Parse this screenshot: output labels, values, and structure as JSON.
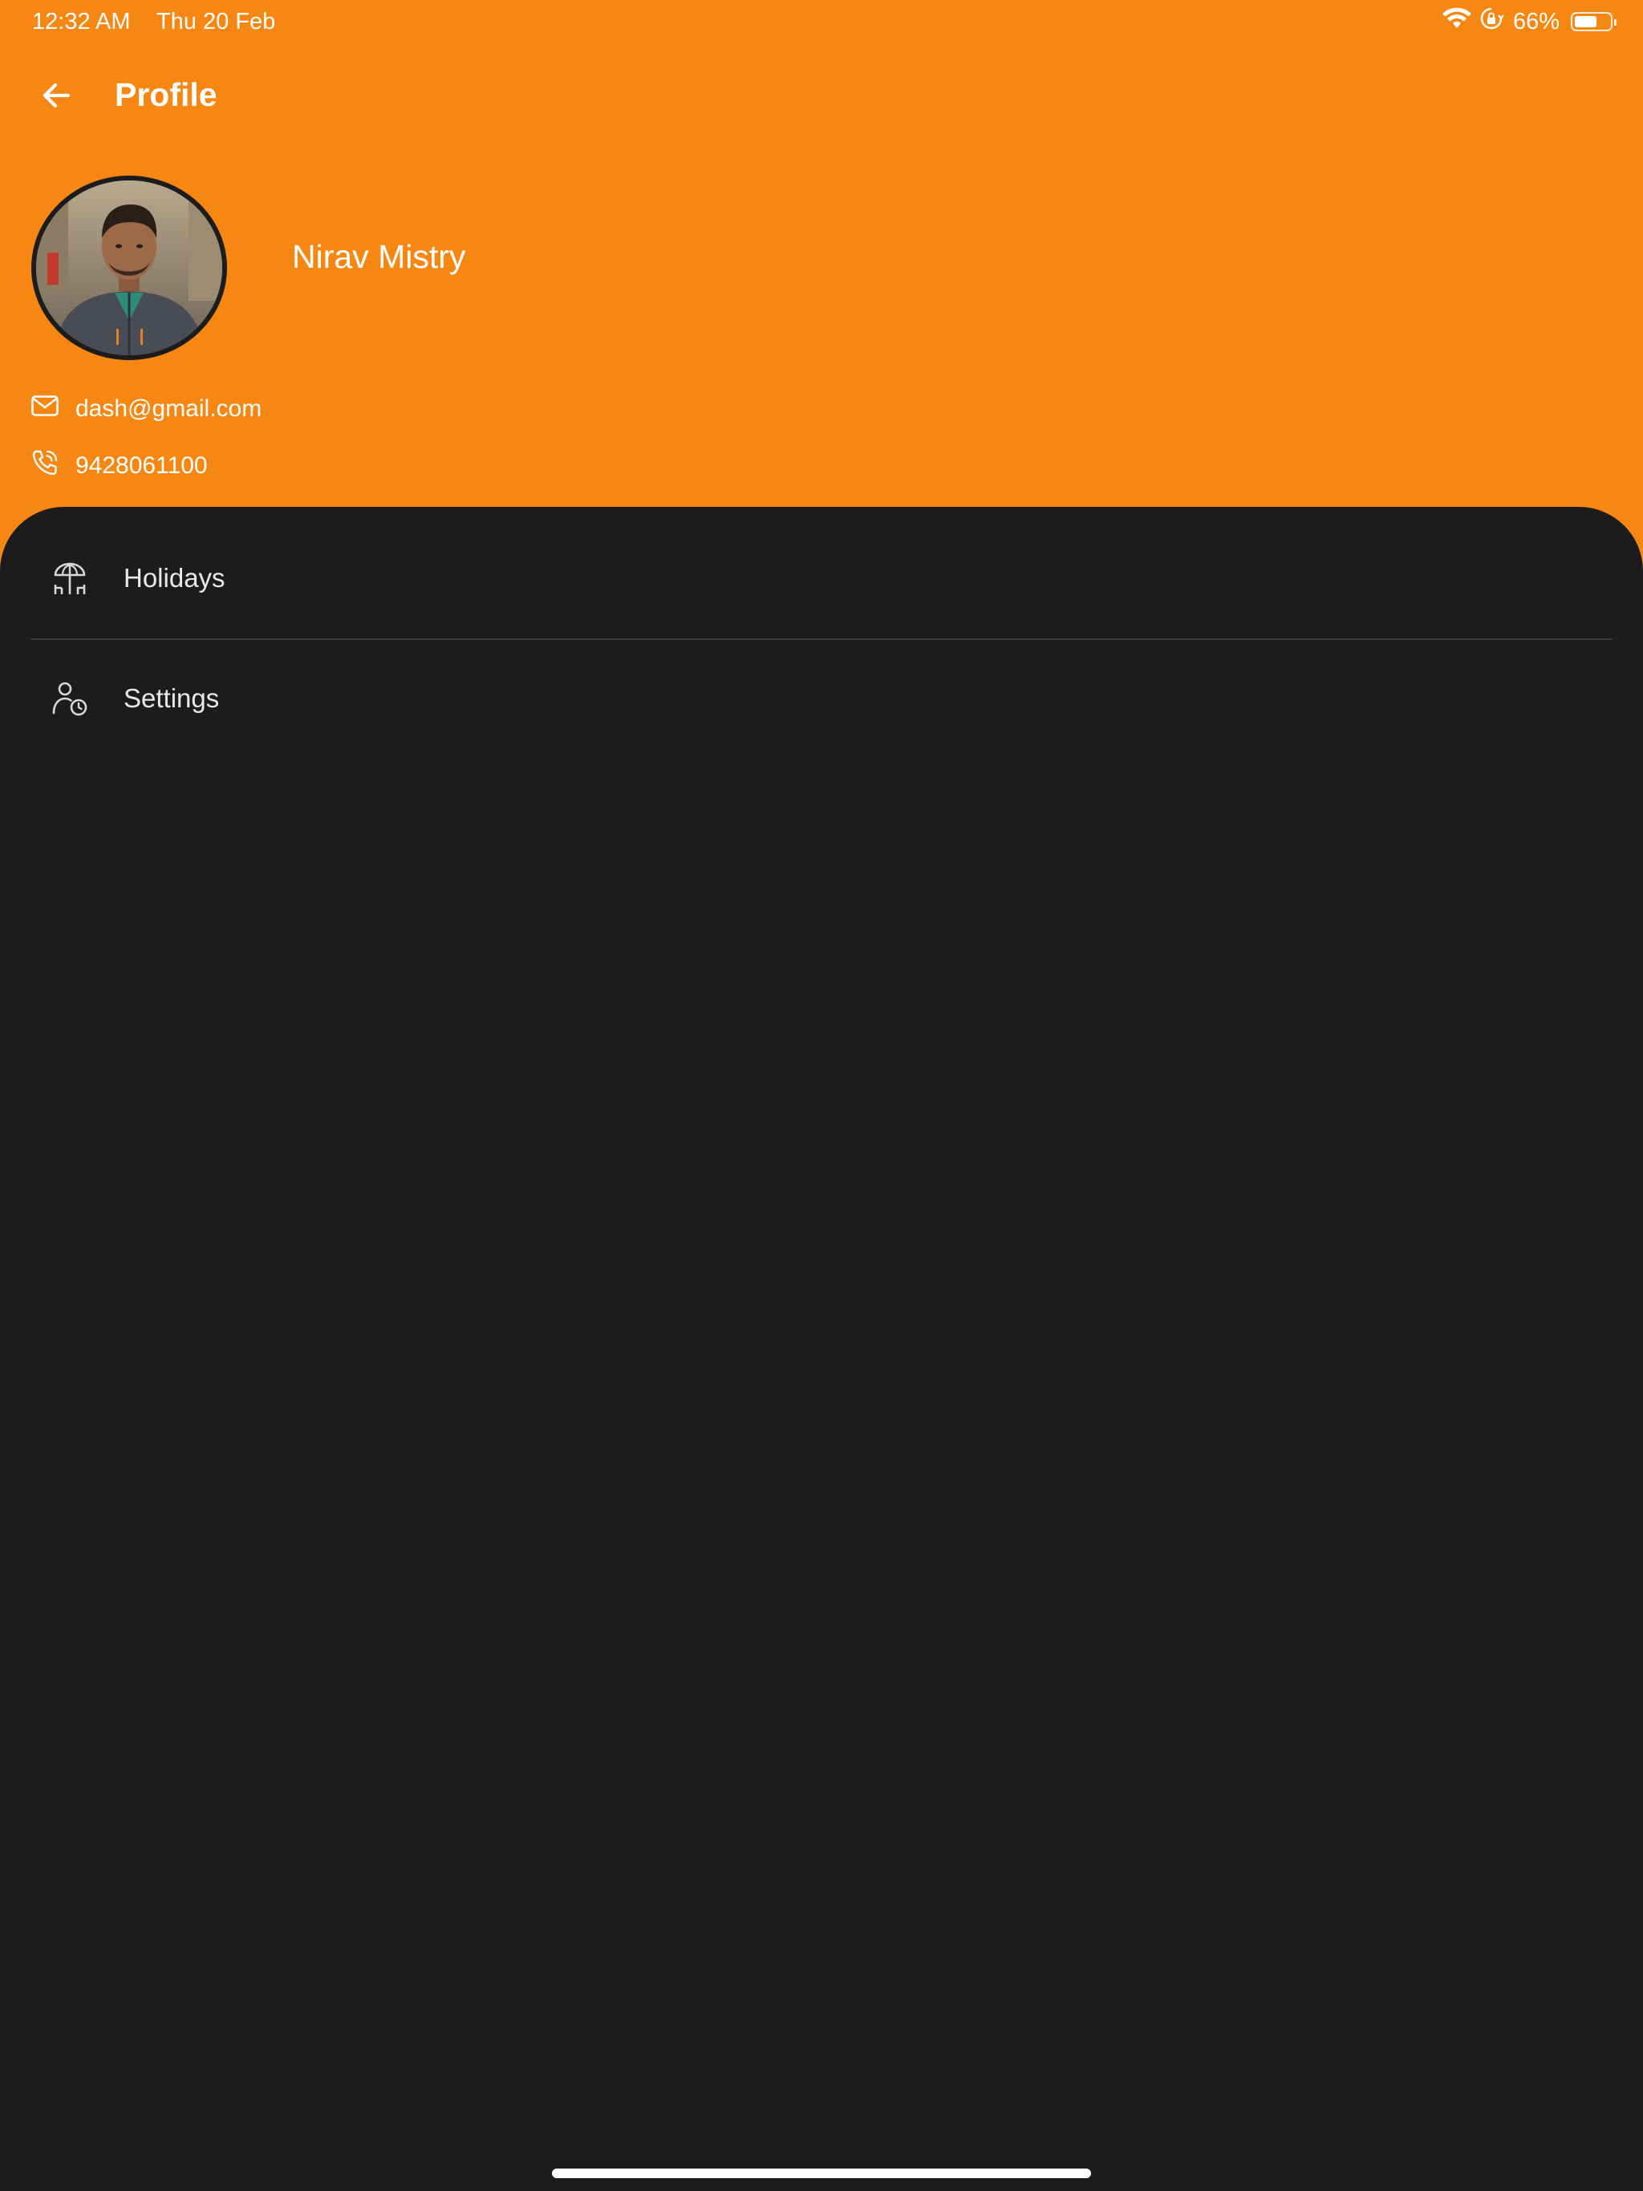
{
  "status_bar": {
    "time": "12:32 AM",
    "date": "Thu 20 Feb",
    "battery_percent": "66%",
    "battery_level": 0.66
  },
  "app_bar": {
    "title": "Profile",
    "back_icon": "arrow-left-icon"
  },
  "profile": {
    "name": "Nirav Mistry",
    "email": "dash@gmail.com",
    "phone": "9428061100",
    "email_icon": "mail-icon",
    "phone_icon": "phone-icon"
  },
  "menu": {
    "items": [
      {
        "label": "Holidays",
        "icon": "beach-umbrella-icon"
      },
      {
        "label": "Settings",
        "icon": "user-clock-icon"
      }
    ]
  },
  "colors": {
    "header_background": "#f58712",
    "sheet_background": "#1c1c1c",
    "text_primary": "#ffffff",
    "divider": "#3c3c3c"
  }
}
